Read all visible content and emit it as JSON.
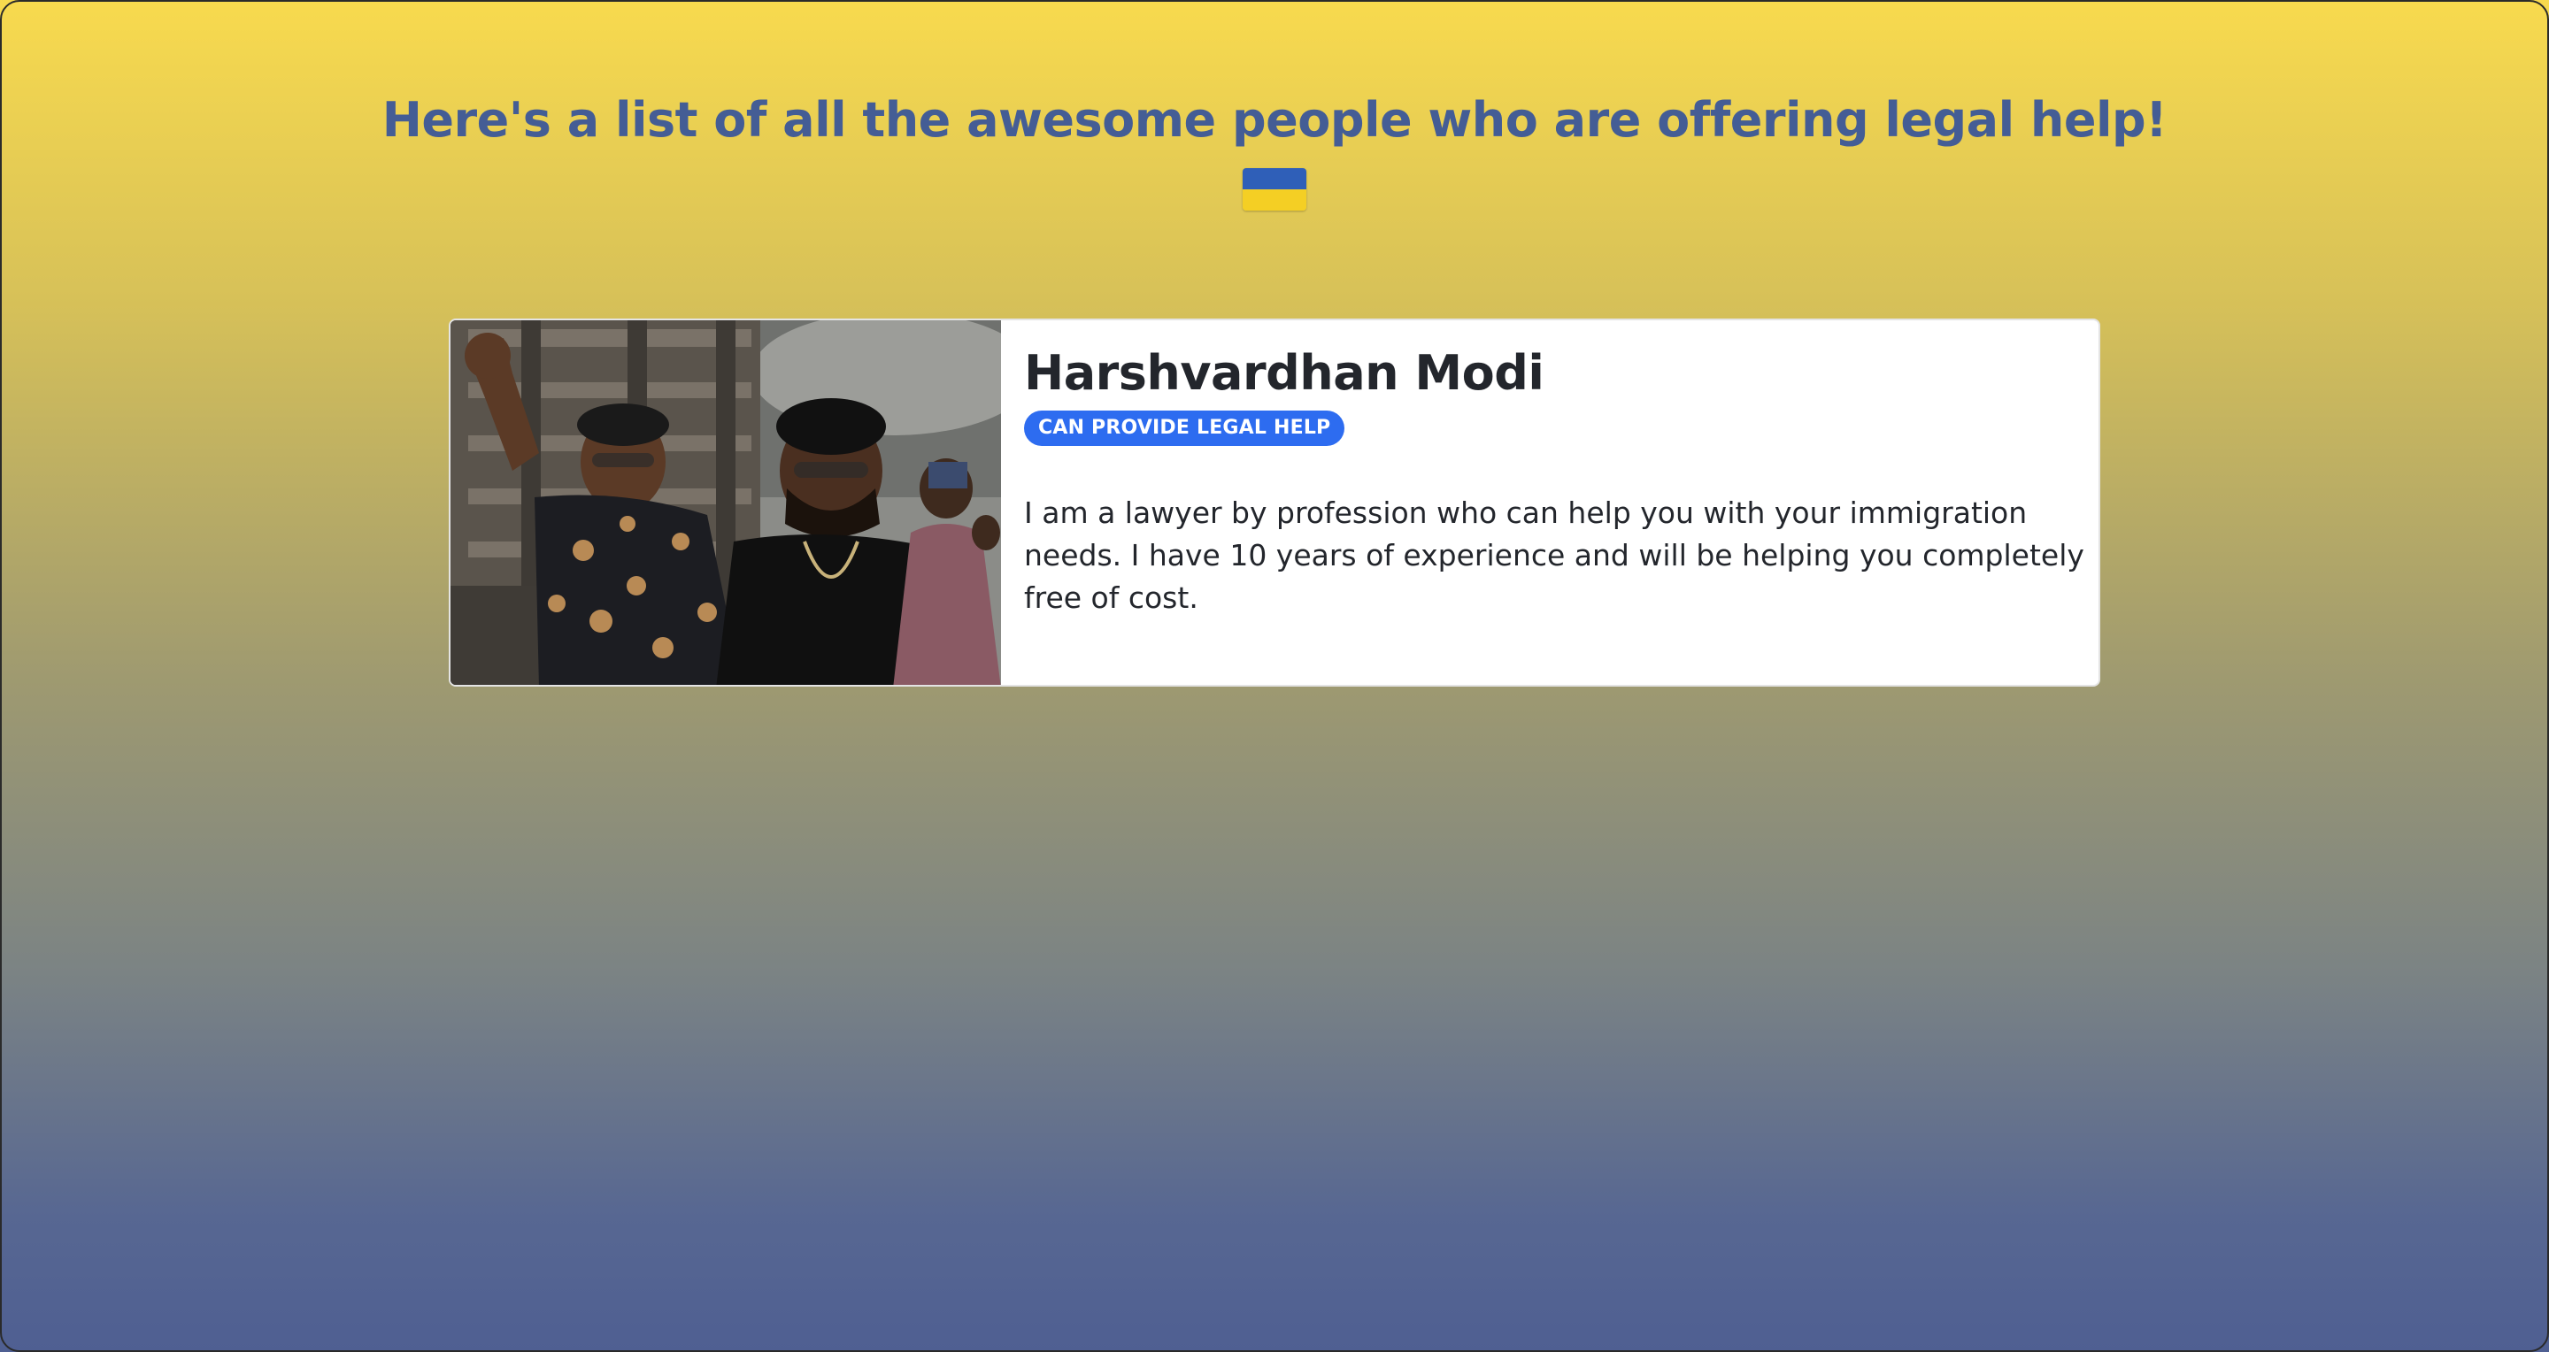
{
  "heading": {
    "text": "Here's a list of all the awesome people who are offering legal help!",
    "flag_icon": "ukraine-flag-icon",
    "flag_colors": [
      "#2f5fb8",
      "#f4cf24"
    ]
  },
  "people": [
    {
      "name": "Harshvardhan Modi",
      "badge": "CAN PROVIDE LEGAL HELP",
      "bio": "I am a lawyer by profession who can help you with your immigration needs. I have 10 years of experience and will be helping you completely free of cost.",
      "photo_icon": "profile-photo"
    }
  ],
  "colors": {
    "heading": "#445d95",
    "badge_bg": "#2d6cf0",
    "card_bg": "#ffffff",
    "gradient_top": "#f8da4e",
    "gradient_bottom": "#4f5f92"
  }
}
